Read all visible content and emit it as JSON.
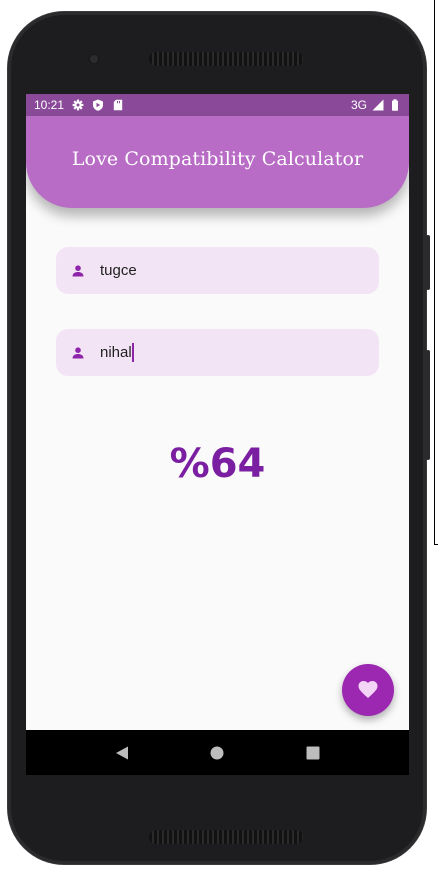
{
  "status_bar": {
    "time": "10:21",
    "network": "3G",
    "icons": [
      "gear-icon",
      "shield-icon",
      "sd-card-icon",
      "signal-icon",
      "battery-icon"
    ]
  },
  "app_bar": {
    "title": "Love Compatibility Calculator"
  },
  "form": {
    "name1": {
      "value": "tugce",
      "icon": "person-icon"
    },
    "name2": {
      "value": "nihal",
      "icon": "person-icon"
    }
  },
  "result": {
    "text": "%64"
  },
  "fab": {
    "icon": "heart-icon"
  },
  "nav_bar": {
    "icons": [
      "back-icon",
      "home-icon",
      "recents-icon"
    ]
  },
  "colors": {
    "status_bar": "#8a4a99",
    "app_bar": "#b86cc6",
    "field_bg": "#f3e4f5",
    "accent": "#9c27b0",
    "result_text": "#7b1fa2"
  }
}
